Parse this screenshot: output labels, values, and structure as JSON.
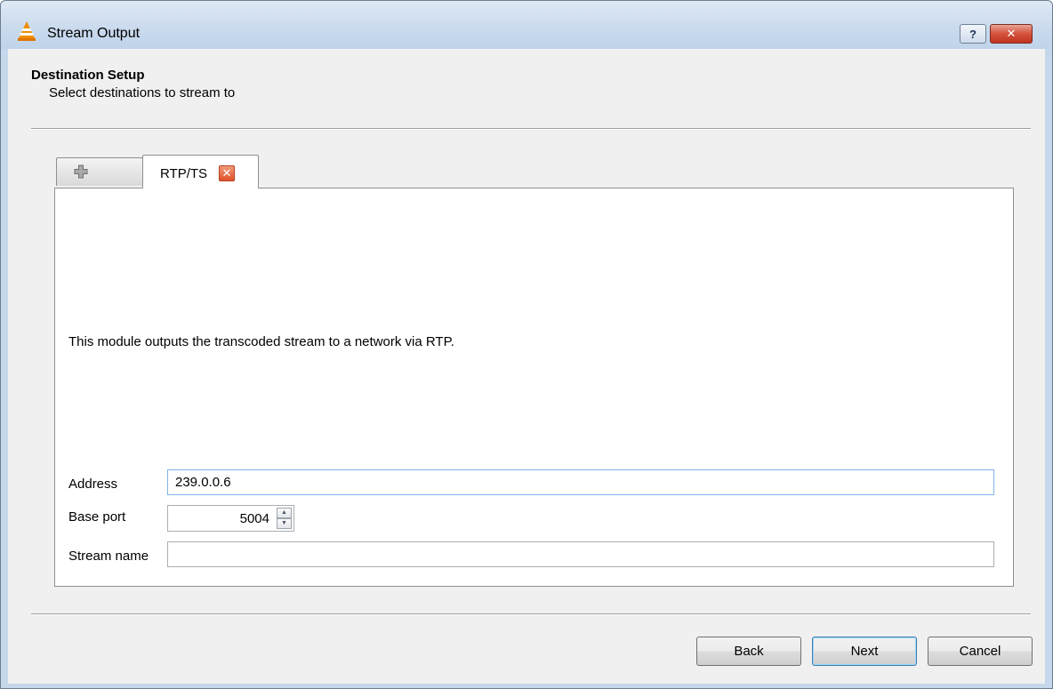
{
  "window": {
    "title": "Stream Output",
    "help_label": "?",
    "close_label": "✕"
  },
  "header": {
    "title": "Destination Setup",
    "subtitle": "Select destinations to stream to"
  },
  "tabs": [
    {
      "icon": "plus-icon"
    },
    {
      "label": "RTP/TS",
      "close_icon": "close-icon",
      "close_label": "✕"
    }
  ],
  "module": {
    "description": "This module outputs the transcoded stream to a network via RTP."
  },
  "form": {
    "address": {
      "label": "Address",
      "value": "239.0.0.6"
    },
    "base_port": {
      "label": "Base port",
      "value": "5004"
    },
    "stream_name": {
      "label": "Stream name",
      "value": ""
    }
  },
  "buttons": {
    "back": "Back",
    "next": "Next",
    "cancel": "Cancel"
  },
  "colors": {
    "accent": "#3c7fb1",
    "close_red": "#d4513c",
    "vlc_orange": "#f08c00"
  }
}
